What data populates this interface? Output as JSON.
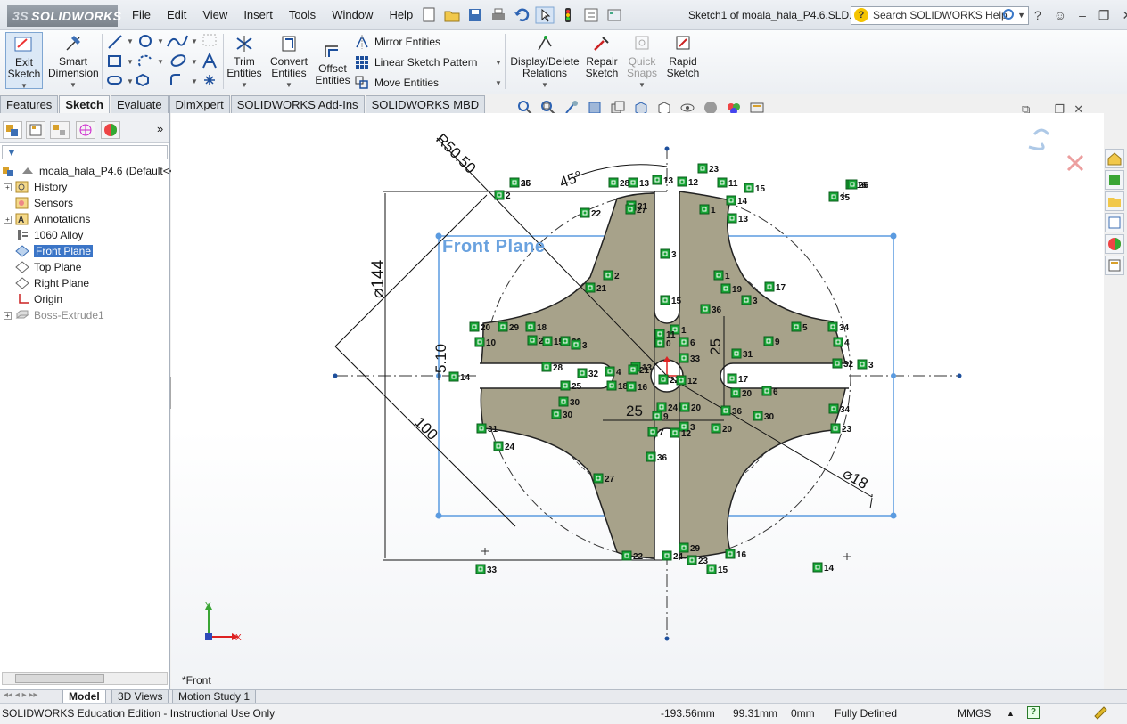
{
  "app": {
    "logo_text": "SOLIDWORKS",
    "doc_title": "Sketch1 of moala_hala_P4.6.SLD..."
  },
  "menu": [
    "File",
    "Edit",
    "View",
    "Insert",
    "Tools",
    "Window",
    "Help"
  ],
  "search": {
    "placeholder": "Search SOLIDWORKS Help"
  },
  "commands": {
    "exit_sketch": "Exit Sketch",
    "smart_dimension": "Smart Dimension",
    "trim_entities": "Trim Entities",
    "convert_entities": "Convert Entities",
    "offset_entities": "Offset Entities",
    "mirror_entities": "Mirror Entities",
    "linear_sketch_pattern": "Linear Sketch Pattern",
    "move_entities": "Move Entities",
    "display_delete_relations": "Display/Delete Relations",
    "repair_sketch": "Repair Sketch",
    "quick_snaps": "Quick Snaps",
    "rapid_sketch": "Rapid Sketch"
  },
  "tabs": [
    "Features",
    "Sketch",
    "Evaluate",
    "DimXpert",
    "SOLIDWORKS Add-Ins",
    "SOLIDWORKS MBD"
  ],
  "active_tab": "Sketch",
  "tree": {
    "root": "moala_hala_P4.6  (Default<<",
    "items": [
      {
        "label": "History",
        "expandable": true
      },
      {
        "label": "Sensors",
        "expandable": false
      },
      {
        "label": "Annotations",
        "expandable": true
      },
      {
        "label": "1060 Alloy",
        "expandable": false
      },
      {
        "label": "Front Plane",
        "expandable": false,
        "selected": true
      },
      {
        "label": "Top Plane",
        "expandable": false
      },
      {
        "label": "Right Plane",
        "expandable": false
      },
      {
        "label": "Origin",
        "expandable": false
      },
      {
        "label": "Boss-Extrude1",
        "expandable": true,
        "dim": true
      }
    ]
  },
  "graphics": {
    "plane_label": "Front Plane",
    "view_name": "*Front",
    "dimensions": [
      "R50.50",
      "45°",
      "⌀144",
      "5.10",
      "100",
      "25",
      "25",
      "⌀18"
    ],
    "triad": {
      "x": "X",
      "y": "Y"
    },
    "relation_tags": [
      "26",
      "2",
      "22",
      "28",
      "13",
      "21",
      "13",
      "12",
      "23",
      "11",
      "15",
      "1",
      "14",
      "13",
      "16",
      "35",
      "2",
      "27",
      "21",
      "3",
      "15",
      "1",
      "19",
      "17",
      "3",
      "36",
      "18",
      "10",
      "20",
      "29",
      "25",
      "15",
      "33",
      "28",
      "3",
      "1",
      "11",
      "6",
      "0",
      "33",
      "5",
      "34",
      "31",
      "9",
      "4",
      "32",
      "14",
      "3",
      "17",
      "6",
      "25",
      "32",
      "4",
      "13",
      "22",
      "18",
      "16",
      "12",
      "21",
      "24",
      "20",
      "30",
      "30",
      "9",
      "20",
      "3",
      "31",
      "24",
      "20",
      "36",
      "30",
      "34",
      "23",
      "29",
      "7",
      "12",
      "27",
      "36",
      "22",
      "24",
      "23",
      "15",
      "16",
      "14",
      "33",
      "26",
      "35"
    ]
  },
  "bottom_tabs": [
    "Model",
    "3D Views",
    "Motion Study 1"
  ],
  "active_bottom_tab": "Model",
  "status": {
    "edition": "SOLIDWORKS Education Edition - Instructional Use Only",
    "x": "-193.56mm",
    "y": "99.31mm",
    "z": "0mm",
    "state": "Fully Defined",
    "units": "MMGS"
  },
  "colors": {
    "accent": "#3b75c7",
    "part_fill": "#a7a28a",
    "plane_border": "#5b9be0",
    "relation_green": "#17a535"
  }
}
